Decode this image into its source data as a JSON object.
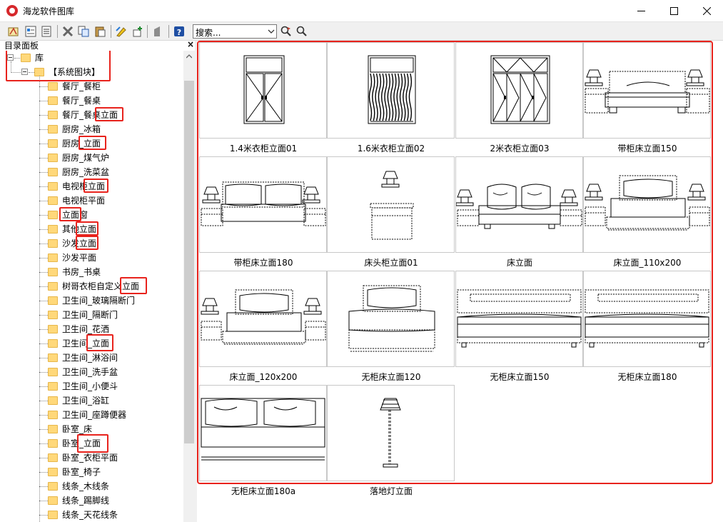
{
  "window": {
    "title": "海龙软件图库"
  },
  "toolbar": {
    "search_placeholder": "搜索..."
  },
  "panel": {
    "title": "目录面板",
    "close": "×"
  },
  "tree": {
    "root": "库",
    "group": "【系统图块】",
    "items": [
      "餐厅_餐柜",
      "餐厅_餐桌",
      "餐厅_餐桌立面",
      "厨房_冰箱",
      "厨房_立面",
      "厨房_煤气炉",
      "厨房_洗菜盆",
      "电视柜立面",
      "电视柜平面",
      "立面窗",
      "其他立面",
      "沙发立面",
      "沙发平面",
      "书房_书桌",
      "树哥衣柜自定义立面",
      "卫生间_玻璃隔断门",
      "卫生间_隔断门",
      "卫生间_花洒",
      "卫生间_立面",
      "卫生间_淋浴间",
      "卫生间_洗手盆",
      "卫生间_小便斗",
      "卫生间_浴缸",
      "卫生间_座蹲便器",
      "卧室_床",
      "卧室_立面",
      "卧室_衣柜平面",
      "卧室_椅子",
      "线条_木线条",
      "线条_踢脚线",
      "线条_天花线条"
    ]
  },
  "thumbnails": [
    {
      "label": "1.4米衣柜立面01",
      "kind": "wardrobe2"
    },
    {
      "label": "1.6米衣柜立面02",
      "kind": "wardrobe-dark"
    },
    {
      "label": "2米衣柜立面03",
      "kind": "wardrobe4"
    },
    {
      "label": "带柜床立面150",
      "kind": "bed-wide"
    },
    {
      "label": "带柜床立面180",
      "kind": "bed-double"
    },
    {
      "label": "床头柜立面01",
      "kind": "nightstand"
    },
    {
      "label": "床立面",
      "kind": "bed-pillows"
    },
    {
      "label": "床立面_110x200",
      "kind": "bed-side"
    },
    {
      "label": "床立面_120x200",
      "kind": "bed-side"
    },
    {
      "label": "无柜床立面120",
      "kind": "bed-single"
    },
    {
      "label": "无柜床立面150",
      "kind": "bed-long"
    },
    {
      "label": "无柜床立面180",
      "kind": "bed-long"
    },
    {
      "label": "无柜床立面180a",
      "kind": "bed-sofa"
    },
    {
      "label": "落地灯立面",
      "kind": "floor-lamp"
    }
  ]
}
